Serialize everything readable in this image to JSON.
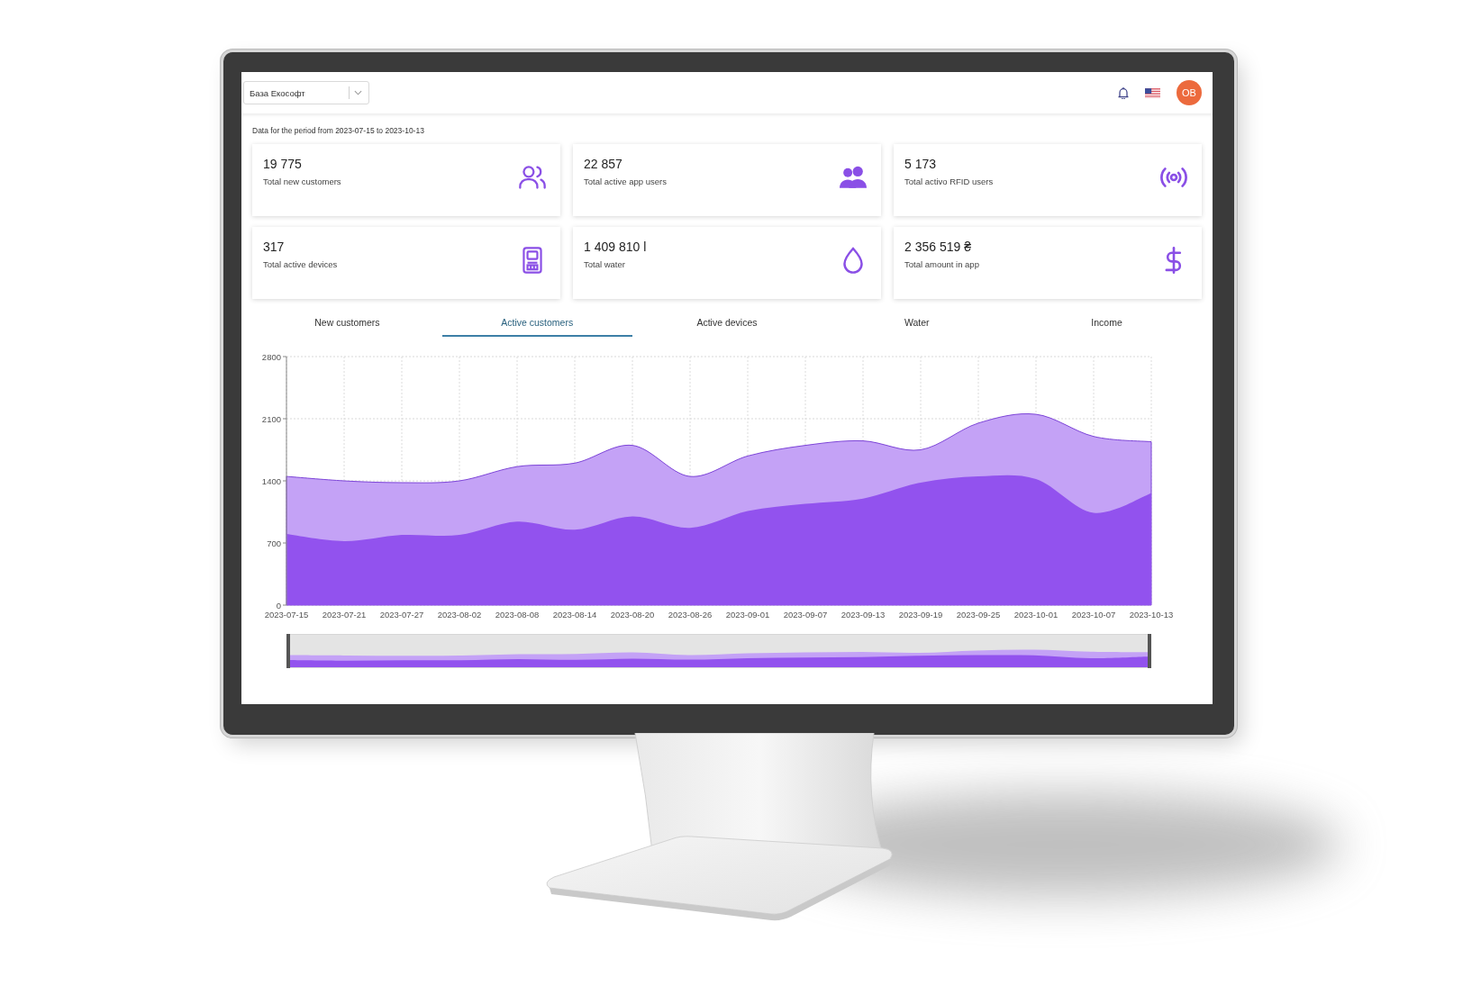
{
  "header": {
    "organization_select": {
      "value": "База Екософт"
    },
    "avatar": {
      "initials": "OB"
    }
  },
  "period_note": "Data for the period from 2023-07-15 to 2023-10-13",
  "stat_cards": [
    {
      "value": "19 775",
      "label": "Total new customers",
      "kind": "customers"
    },
    {
      "value": "22 857",
      "label": "Total active app users",
      "kind": "users"
    },
    {
      "value": "5 173",
      "label": "Total activo RFID users",
      "kind": "rfid"
    },
    {
      "value": "317",
      "label": "Total active devices",
      "kind": "devices"
    },
    {
      "value": "1 409 810 l",
      "label": "Total water",
      "kind": "water"
    },
    {
      "value": "2 356 519 ₴",
      "label": "Total amount in app",
      "kind": "money"
    }
  ],
  "chart_tabs": [
    {
      "label": "New customers",
      "selected": false
    },
    {
      "label": "Active customers",
      "selected": true
    },
    {
      "label": "Active devices",
      "selected": false
    },
    {
      "label": "Water",
      "selected": false
    },
    {
      "label": "Income",
      "selected": false
    }
  ],
  "chart": {
    "chart_data": {
      "type": "area",
      "categories": [
        "2023-07-15",
        "2023-07-21",
        "2023-07-27",
        "2023-08-02",
        "2023-08-08",
        "2023-08-14",
        "2023-08-20",
        "2023-08-26",
        "2023-09-01",
        "2023-09-07",
        "2023-09-13",
        "2023-09-19",
        "2023-09-25",
        "2023-10-01",
        "2023-10-07",
        "2023-10-13"
      ],
      "ylim": [
        0,
        2800
      ],
      "yticks": [
        0,
        700,
        1400,
        2100,
        2800
      ],
      "grid": true,
      "series": [
        {
          "color": "#c4a2f6",
          "values": [
            1450,
            1400,
            1380,
            1400,
            1560,
            1600,
            1800,
            1450,
            1680,
            1800,
            1850,
            1750,
            2050,
            2150,
            1900,
            1840
          ]
        },
        {
          "color": "#9252ee",
          "values": [
            800,
            720,
            790,
            790,
            940,
            850,
            1000,
            870,
            1060,
            1140,
            1200,
            1380,
            1450,
            1420,
            1040,
            1260
          ]
        }
      ]
    }
  }
}
